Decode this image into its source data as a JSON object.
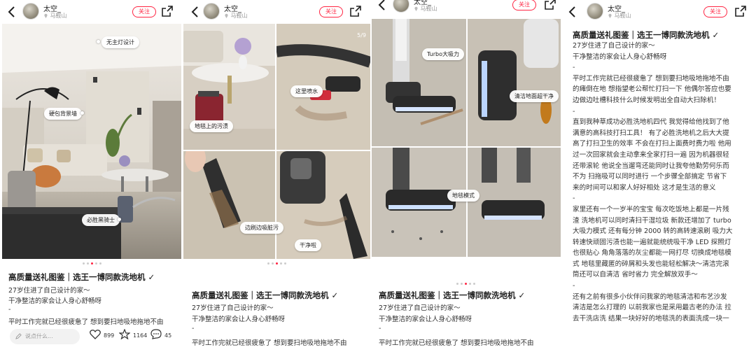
{
  "user": {
    "name": "太空_",
    "location": "马鞍山",
    "follow_label": "关注"
  },
  "post": {
    "title": "高质量送礼图鉴｜选王一博同款洗地机 ✓",
    "line1": "27岁住进了自己设计的家～",
    "line2": "干净整洁的家会让人身心舒畅呀",
    "separator": "-",
    "line3": "平时工作完就已经很疲惫了 想到要扫地吸地拖地不由"
  },
  "panel1": {
    "tags": [
      "无主灯设计",
      "硬包背景墙",
      "必胜黑骑士"
    ],
    "comment_placeholder": "说点什么...",
    "likes": "899",
    "collects": "1164",
    "comments": "45"
  },
  "panel2": {
    "page_indicator": "5/9",
    "tags": [
      "这里喷水",
      "地毯上的污渍",
      "边刷边吸脏污",
      "干净啦"
    ]
  },
  "panel3": {
    "tags": [
      "Turbo大吸力",
      "清洁地面超干净",
      "地毯模式"
    ]
  },
  "panel4": {
    "paragraphs": [
      "平时工作完就已经很疲惫了 想到要扫地吸地拖地不由",
      "的瘫倒在地 想指望老公帮忙打扫一下 他偶尔答应也要",
      "边做边吐槽科技什么时候发明出全自动大扫除机！",
      "-",
      "直到我种草成功必胜洗地机四代 我觉得给他找到了他",
      "满意的高科技打扫工具！ 有了必胜洗地机之后大大提",
      "高了打扫卫生的效率 不会在打扫上面费时费力啦 他用",
      "过一次回家就会主动拿来全家打扫一遍 因为机器很轻",
      "还带滚轮 他说全当遛弯还能同时让我夸他勤劳何乐而",
      "不为 扫拖吸可以同时进行 一个步骤全部搞定 节省下",
      "来的时间可以和家人好好相处 这才是生活的意义",
      "-",
      "家里还有一个一岁半的宝宝 每次吃饭地上都是一片残",
      "渣 洗地机可以同时清扫干湿垃圾 新款还增加了 turbo",
      "大吸力模式 还有每分钟 2000 转的高转速滚刷 吸力大",
      "转速快顽固污渍也能一遍就能统统吸干净 LED 探照灯",
      "也很贴心 角角落落的灰尘都能一网打尽 切换成地毯模",
      "式 地毯里藏匿的碎屑和头发也能轻松解决～清洁完滚",
      "筒还可以自清洁 省时省力 完全解放双手～",
      "-",
      "还有之前有很多小伙伴问我家的地毯清洁和布艺沙发",
      "清洁是怎么打理的 以前我家也是采用最古老的办法 拉",
      "去干洗店洗 结果一块好好的地毯洗的表面洗成一块一"
    ]
  }
}
